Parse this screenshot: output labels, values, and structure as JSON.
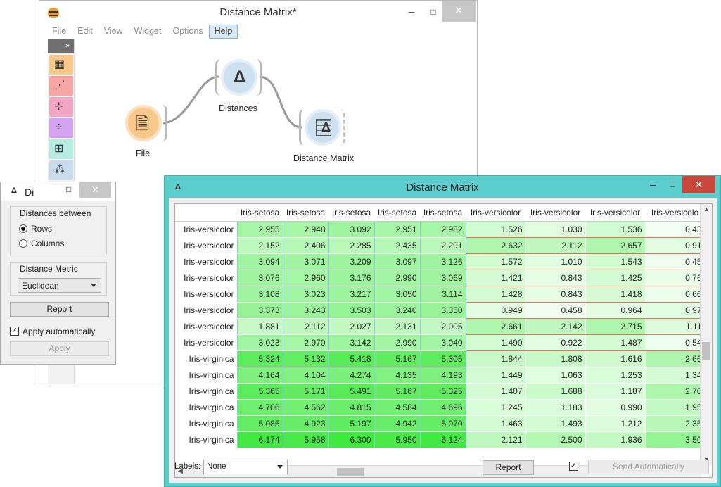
{
  "canvas_window": {
    "title": "Distance Matrix*",
    "menu": [
      "File",
      "Edit",
      "View",
      "Widget",
      "Options",
      "Help"
    ],
    "toolbox_collapse": "»",
    "toolbox_categories": [
      {
        "name": "data",
        "color": "#f9c98b",
        "glyph": "▦"
      },
      {
        "name": "visualize",
        "color": "#f6a5a5",
        "glyph": "⋰"
      },
      {
        "name": "model",
        "color": "#f3a5c4",
        "glyph": "⊹"
      },
      {
        "name": "unsupervised",
        "color": "#d4a3f0",
        "glyph": "⁘"
      },
      {
        "name": "evaluate",
        "color": "#b7ece3",
        "glyph": "⊞"
      },
      {
        "name": "other",
        "color": "#c9dcef",
        "glyph": "⁂"
      }
    ],
    "nodes": {
      "file": {
        "label": "File",
        "glyph": "🗎"
      },
      "distances": {
        "label": "Distances",
        "glyph": "Δ"
      },
      "matrix": {
        "label": "Distance Matrix",
        "glyph": "Δ"
      }
    }
  },
  "distances_widget": {
    "title": "Di",
    "title_icon": "Δ",
    "group_between": "Distances between",
    "rows_label": "Rows",
    "columns_label": "Columns",
    "selected": "Rows",
    "metric_group": "Distance Metric",
    "metric_value": "Euclidean",
    "report_label": "Report",
    "apply_auto_label": "Apply automatically",
    "apply_auto_checked": true,
    "apply_label": "Apply"
  },
  "matrix_window": {
    "title": "Distance Matrix",
    "title_icon": "Δ",
    "col_headers": [
      "Iris-setosa",
      "Iris-setosa",
      "Iris-setosa",
      "Iris-setosa",
      "Iris-setosa",
      "Iris-versicolor",
      "Iris-versicolor",
      "Iris-versicolor",
      "Iris-versicolo"
    ],
    "rows": [
      {
        "label": "Iris-versicolor",
        "values": [
          "2.955",
          "2.948",
          "3.092",
          "2.951",
          "2.982",
          "1.526",
          "1.030",
          "1.536",
          "0.43"
        ]
      },
      {
        "label": "Iris-versicolor",
        "values": [
          "2.152",
          "2.406",
          "2.285",
          "2.435",
          "2.291",
          "2.632",
          "2.112",
          "2.657",
          "0.91"
        ]
      },
      {
        "label": "Iris-versicolor",
        "values": [
          "3.094",
          "3.071",
          "3.209",
          "3.097",
          "3.126",
          "1.572",
          "1.010",
          "1.543",
          "0.45"
        ]
      },
      {
        "label": "Iris-versicolor",
        "values": [
          "3.076",
          "2.960",
          "3.176",
          "2.990",
          "3.069",
          "1.421",
          "0.843",
          "1.425",
          "0.76"
        ]
      },
      {
        "label": "Iris-versicolor",
        "values": [
          "3.108",
          "3.023",
          "3.217",
          "3.050",
          "3.114",
          "1.428",
          "0.843",
          "1.418",
          "0.66"
        ]
      },
      {
        "label": "Iris-versicolor",
        "values": [
          "3.373",
          "3.243",
          "3.503",
          "3.240",
          "3.350",
          "0.949",
          "0.458",
          "0.964",
          "0.97"
        ]
      },
      {
        "label": "Iris-versicolor",
        "values": [
          "1.881",
          "2.112",
          "2.027",
          "2.131",
          "2.005",
          "2.661",
          "2.142",
          "2.715",
          "1.11"
        ]
      },
      {
        "label": "Iris-versicolor",
        "values": [
          "3.023",
          "2.970",
          "3.142",
          "2.990",
          "3.040",
          "1.490",
          "0.922",
          "1.487",
          "0.54"
        ]
      },
      {
        "label": "Iris-virginica",
        "values": [
          "5.324",
          "5.132",
          "5.418",
          "5.167",
          "5.305",
          "1.844",
          "1.808",
          "1.616",
          "2.66"
        ]
      },
      {
        "label": "Iris-virginica",
        "values": [
          "4.164",
          "4.104",
          "4.274",
          "4.135",
          "4.193",
          "1.449",
          "1.063",
          "1.253",
          "1.34"
        ]
      },
      {
        "label": "Iris-virginica",
        "values": [
          "5.365",
          "5.171",
          "5.491",
          "5.167",
          "5.325",
          "1.407",
          "1.688",
          "1.187",
          "2.70"
        ]
      },
      {
        "label": "Iris-virginica",
        "values": [
          "4.706",
          "4.562",
          "4.815",
          "4.584",
          "4.696",
          "1.245",
          "1.183",
          "0.990",
          "1.95"
        ]
      },
      {
        "label": "Iris-virginica",
        "values": [
          "5.085",
          "4.923",
          "5.197",
          "4.942",
          "5.070",
          "1.463",
          "1.493",
          "1.212",
          "2.35"
        ]
      },
      {
        "label": "Iris-virginica",
        "values": [
          "6.174",
          "5.958",
          "6.300",
          "5.950",
          "6.124",
          "2.121",
          "2.500",
          "1.936",
          "3.50"
        ]
      }
    ],
    "labels_caption": "Labels:",
    "labels_value": "None",
    "report_label": "Report",
    "send_auto_checked": true,
    "send_auto_label": "Send Automatically",
    "colors": {
      "max_green": "#3ee83e",
      "min_green": "#f2fff2"
    }
  }
}
